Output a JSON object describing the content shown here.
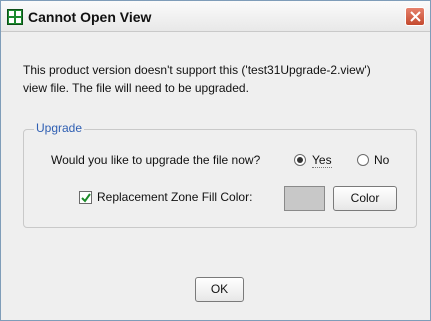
{
  "window": {
    "title": "Cannot Open View",
    "icon": "grid-window-icon",
    "close_icon": "close-icon",
    "accent": "#2f5fb3"
  },
  "message": {
    "line1": "This product version doesn't support this ('test31Upgrade-2.view')",
    "line2": "view file. The file will need to be upgraded."
  },
  "upgrade_group": {
    "label": "Upgrade",
    "question": "Would you like to upgrade the file now?",
    "yes_label": "Yes",
    "no_label": "No",
    "selected": "Yes",
    "replacement_label": "Replacement Zone Fill Color:",
    "replacement_checked": true,
    "swatch_color": "#c8c8c8",
    "color_button": "Color"
  },
  "buttons": {
    "ok": "OK"
  }
}
